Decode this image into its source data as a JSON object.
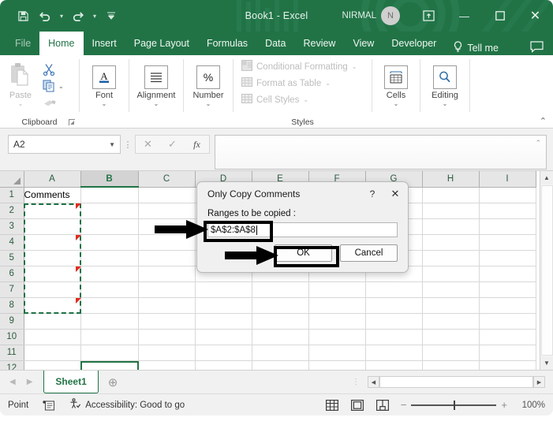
{
  "titlebar": {
    "doc_title": "Book1  -  Excel",
    "user_name": "NIRMAL",
    "avatar_initial": "N",
    "save_icon": "save-icon",
    "undo_icon": "undo-icon",
    "redo_icon": "redo-icon",
    "customize_qat_icon": "customize-quick-access-toolbar-icon",
    "ribbon_display_icon": "ribbon-display-options-icon",
    "minimize_icon": "minimize-icon",
    "maximize_icon": "maximize-icon",
    "close_icon": "close-icon"
  },
  "ribbon_tabs": [
    {
      "label": "File",
      "active": false
    },
    {
      "label": "Home",
      "active": true
    },
    {
      "label": "Insert",
      "active": false
    },
    {
      "label": "Page Layout",
      "active": false
    },
    {
      "label": "Formulas",
      "active": false
    },
    {
      "label": "Data",
      "active": false
    },
    {
      "label": "Review",
      "active": false
    },
    {
      "label": "View",
      "active": false
    },
    {
      "label": "Developer",
      "active": false
    }
  ],
  "tellme": {
    "label": "Tell me",
    "icon": "lightbulb-icon"
  },
  "comments_button": {
    "icon": "comment-icon"
  },
  "ribbon": {
    "clipboard": {
      "group_label": "Clipboard",
      "paste_label": "Paste",
      "cut_icon": "scissors-icon",
      "copy_icon": "copy-icon",
      "format_painter_icon": "format-painter-icon",
      "dialog_launcher_icon": "dialog-launcher-icon"
    },
    "font": {
      "group_label": "Font",
      "label": "Font",
      "icon": "font-A-icon"
    },
    "alignment": {
      "group_label": "Alignment",
      "label": "Alignment",
      "icon": "alignment-lines-icon"
    },
    "number": {
      "group_label": "Number",
      "label": "Number",
      "icon": "percent-icon"
    },
    "styles": {
      "group_label": "Styles",
      "items": [
        {
          "label": "Conditional Formatting",
          "icon": "conditional-formatting-icon"
        },
        {
          "label": "Format as Table",
          "icon": "format-as-table-icon"
        },
        {
          "label": "Cell Styles",
          "icon": "cell-styles-icon"
        }
      ]
    },
    "cells": {
      "group_label": "",
      "label": "Cells",
      "icon": "cells-icon"
    },
    "editing": {
      "group_label": "",
      "label": "Editing",
      "icon": "magnifier-icon"
    },
    "collapse_icon": "collapse-ribbon-icon"
  },
  "formula_bar": {
    "name_box_value": "A2",
    "name_box_arrow_icon": "dropdown-arrow-icon",
    "cancel_icon": "cancel-x-icon",
    "enter_icon": "enter-check-icon",
    "function_icon": "fx",
    "formula_value": "",
    "expand_icon": "expand-formula-bar-icon"
  },
  "grid": {
    "columns": [
      "A",
      "B",
      "C",
      "D",
      "E",
      "F",
      "G",
      "H",
      "I"
    ],
    "active_column": "B",
    "rows": [
      1,
      2,
      3,
      4,
      5,
      6,
      7,
      8,
      9,
      10,
      11,
      12
    ],
    "cells": {
      "A1": "Comments"
    },
    "selection_range": "A2:A8",
    "active_cell": "B12",
    "comment_rows": [
      2,
      4,
      6,
      8
    ],
    "scroll_up_icon": "scroll-up-icon",
    "scroll_down_icon": "scroll-down-icon"
  },
  "sheet_tabs": {
    "prev_icon": "previous-sheet-icon",
    "next_icon": "next-sheet-icon",
    "tabs": [
      {
        "label": "Sheet1",
        "active": true
      }
    ],
    "add_sheet_icon": "add-sheet-icon",
    "hscroll_left_icon": "scroll-left-icon",
    "hscroll_right_icon": "scroll-right-icon"
  },
  "status_bar": {
    "mode": "Point",
    "macro_icon": "record-macro-icon",
    "accessibility_icon": "accessibility-icon",
    "accessibility_text": "Accessibility: Good to go",
    "view_normal_icon": "normal-view-icon",
    "view_pagelayout_icon": "page-layout-view-icon",
    "view_pagebreak_icon": "page-break-preview-icon",
    "zoom_out_icon": "zoom-out-icon",
    "zoom_in_icon": "zoom-in-icon",
    "zoom_level": "100%"
  },
  "dialog": {
    "title": "Only Copy Comments",
    "help_icon": "?",
    "close_icon": "close-icon",
    "field_label": "Ranges to be copied :",
    "field_value": "$A$2:$A$8",
    "ok_label": "OK",
    "cancel_label": "Cancel"
  },
  "colors": {
    "excel_green": "#217346",
    "selection_green": "#1e7145",
    "comment_red": "#e02b20",
    "annotation_black": "#000000"
  }
}
